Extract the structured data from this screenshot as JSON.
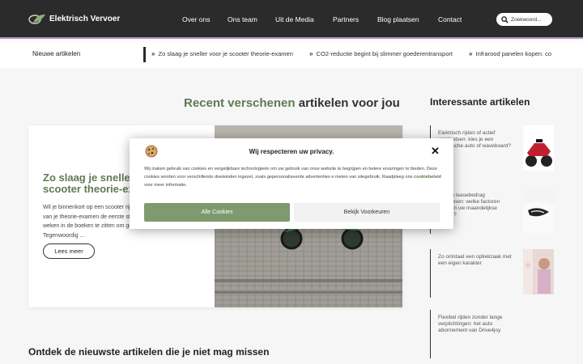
{
  "header": {
    "logo_text": "Elektrisch Vervoer",
    "nav": [
      "Over ons",
      "Ons team",
      "Uit de Media",
      "Partners",
      "Blog plaatsen",
      "Contact"
    ],
    "search_placeholder": "Zoekwoord..."
  },
  "ticker": {
    "label": "Nieuwe artikelen",
    "items": [
      "Zo slaag je sneller voor je scooter theorie-examen",
      "CO2-reductie begint bij slimmer goederentransport",
      "Infrarood panelen kopen: co"
    ]
  },
  "recent": {
    "title_part1": "Recent verschenen",
    "title_part2": " artikelen voor jou"
  },
  "featured": {
    "title": "Zo slaag je sneller voor je scooter theorie-examen",
    "excerpt": "Wil je binnenkort op een scooter rijden? Dan is het behalen van je theorie-examen de eerste stap. Gelukkig hoef je niet weken in de boeken te zitten om goed voorbereid te zijn. Tegenwoordig ...",
    "button": "Lees meer"
  },
  "sidebar": {
    "title": "Interessante artikelen",
    "items": [
      {
        "text": "Elektrisch rijden of actief verplaatsen: kies je een elektrische auto of waveboard?",
        "thumb": "quad-icon"
      },
      {
        "text": "Private leasebedrag berekenen: welke factoren bepalen uw maandelijkse kosten?",
        "thumb": "car-headlight-icon"
      },
      {
        "text": "Zo ontstaat een optiekzaak met een eigen karakter",
        "thumb": "optician-icon"
      },
      {
        "text": "Flexibel rijden zonder lange verplichtingen: het auto abonnement van Drive4joy",
        "thumb": ""
      }
    ]
  },
  "bottom": {
    "title": "Ontdek de nieuwste artikelen die je niet mag missen"
  },
  "cookie": {
    "title": "Wij respecteren uw privacy.",
    "body_1": "Wij maken gebruik van cookies en vergelijkbare technologieën om uw gebruik van onze website te begrijpen en betere ervaringen te bieden. Deze cookies worden voor verschillende doeleinden ingezet, zoals gepersonaliseerde advertenties e meten van sitegebruik. Raadpleeg ons ",
    "link": "cookiebeleid",
    "body_2": " voor meer informatie.",
    "accept": "Alle Cookies",
    "prefs": "Bekijk Voorkeuren"
  },
  "colors": {
    "accent_green": "#5f7a52",
    "button_green": "#7f9a6e",
    "header_bg": "#2b2b2b",
    "header_border": "#b08fc0"
  }
}
